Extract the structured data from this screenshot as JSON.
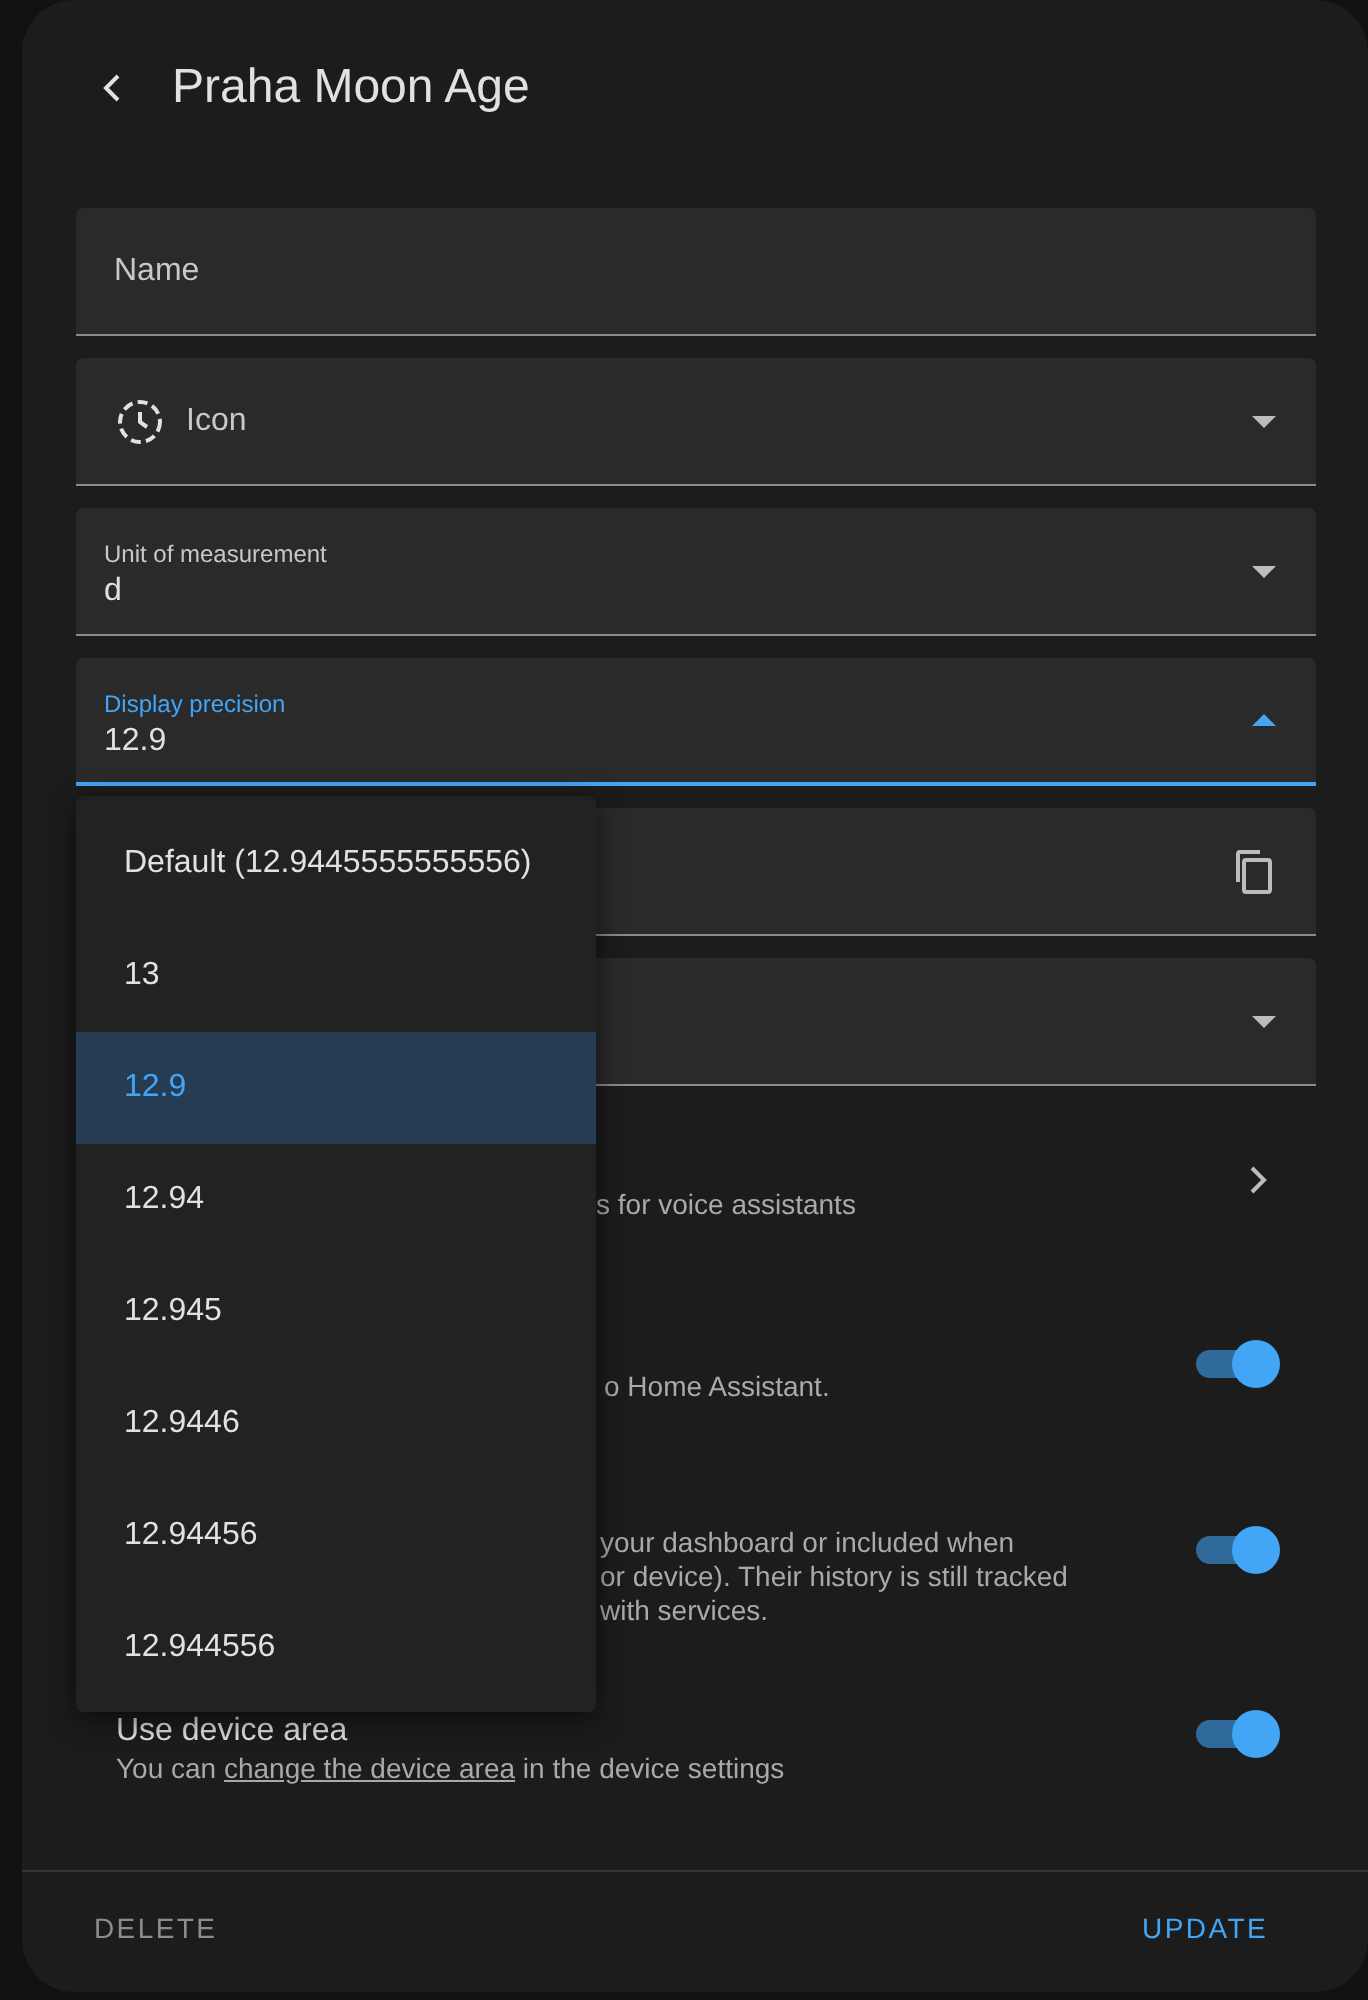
{
  "header": {
    "title": "Praha Moon Age"
  },
  "fields": [
    {
      "kind": "text",
      "label": "Name"
    },
    {
      "kind": "icon-select",
      "label": "Icon"
    },
    {
      "kind": "select",
      "label": "Unit of measurement",
      "value": "d",
      "focused": false
    },
    {
      "kind": "select",
      "label": "Display precision",
      "value": "12.9",
      "focused": true
    },
    {
      "kind": "copy"
    },
    {
      "kind": "select-empty"
    }
  ],
  "settings": [
    {
      "kind": "link",
      "subtitle_lines": [
        "s for voice assistants"
      ]
    },
    {
      "kind": "toggle",
      "on": true,
      "subtitle_lines": [
        "o Home Assistant."
      ]
    },
    {
      "kind": "toggle",
      "on": true,
      "subtitle_lines": [
        "your dashboard or included when",
        "or device). Their history is still tracked",
        "with services."
      ]
    },
    {
      "kind": "toggle",
      "on": true,
      "title": "Use device area",
      "subtitle_before": "You can ",
      "link": "change the device area",
      "subtitle_after": " in the device settings"
    }
  ],
  "menu": {
    "options": [
      {
        "label": "Default (12.9445555555556)",
        "selected": false
      },
      {
        "label": "13",
        "selected": false
      },
      {
        "label": "12.9",
        "selected": true
      },
      {
        "label": "12.94",
        "selected": false
      },
      {
        "label": "12.945",
        "selected": false
      },
      {
        "label": "12.9446",
        "selected": false
      },
      {
        "label": "12.94456",
        "selected": false
      },
      {
        "label": "12.944556",
        "selected": false
      }
    ]
  },
  "footer": {
    "delete": "DELETE",
    "update": "UPDATE"
  }
}
